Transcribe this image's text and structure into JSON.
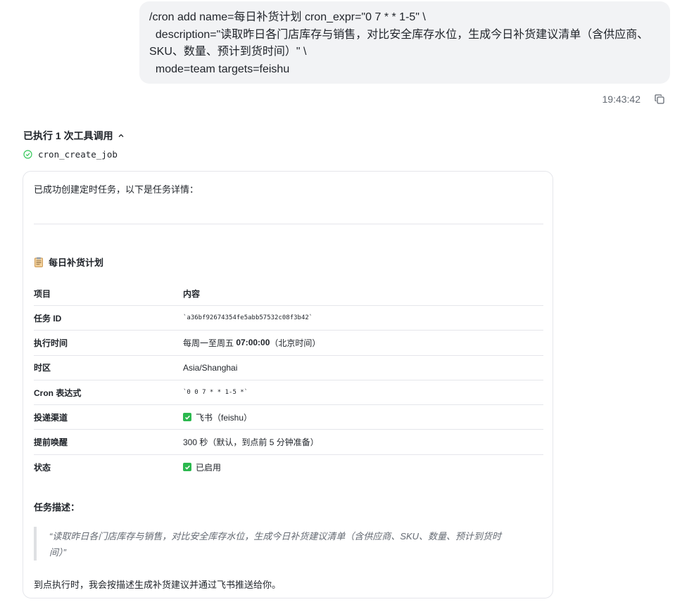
{
  "user_message": {
    "lines": [
      "/cron add name=每日补货计划 cron_expr=\"0 7 * * 1-5\" \\",
      "  description=\"读取昨日各门店库存与销售，对比安全库存水位，生成今日补货建议清单（含供应商、",
      "SKU、数量、预计到货时间）\" \\",
      "  mode=team targets=feishu"
    ],
    "timestamp": "19:43:42"
  },
  "tool_section": {
    "header": "已执行 1 次工具调用",
    "tool_name": "cron_create_job"
  },
  "card": {
    "intro": "已成功创建定时任务，以下是任务详情：",
    "title_icon": "clipboard-icon",
    "title": "每日补货计划",
    "table": {
      "headers": [
        "项目",
        "内容"
      ],
      "rows": {
        "task_id": {
          "label": "任务 ID",
          "value": "`a36bf92674354fe5abb57532c08f3b42`"
        },
        "schedule": {
          "label": "执行时间",
          "prefix": "每周一至周五 ",
          "bold": "07:00:00",
          "suffix": "（北京时间）"
        },
        "timezone": {
          "label": "时区",
          "value": "Asia/Shanghai"
        },
        "cron": {
          "label": "Cron 表达式",
          "value": "`0 0 7 * * 1-5 *`"
        },
        "channel": {
          "label": "投递渠道",
          "value": "飞书（feishu）"
        },
        "reminder": {
          "label": "提前唤醒",
          "value": "300 秒（默认，到点前 5 分钟准备）"
        },
        "status": {
          "label": "状态",
          "value": "已启用"
        }
      }
    },
    "description_title": "任务描述：",
    "quote_line1": "“读取昨日各门店库存与销售，对比安全库存水位，生成今日补货建议清单（含供应商、SKU、数量、预计到货时",
    "quote_line2": "间）”",
    "closing": "到点执行时，我会按描述生成补货建议并通过飞书推送给你。"
  },
  "colors": {
    "check_green": "#2bb84e",
    "success_green": "#34c759",
    "bubble_bg": "#f2f3f5"
  }
}
